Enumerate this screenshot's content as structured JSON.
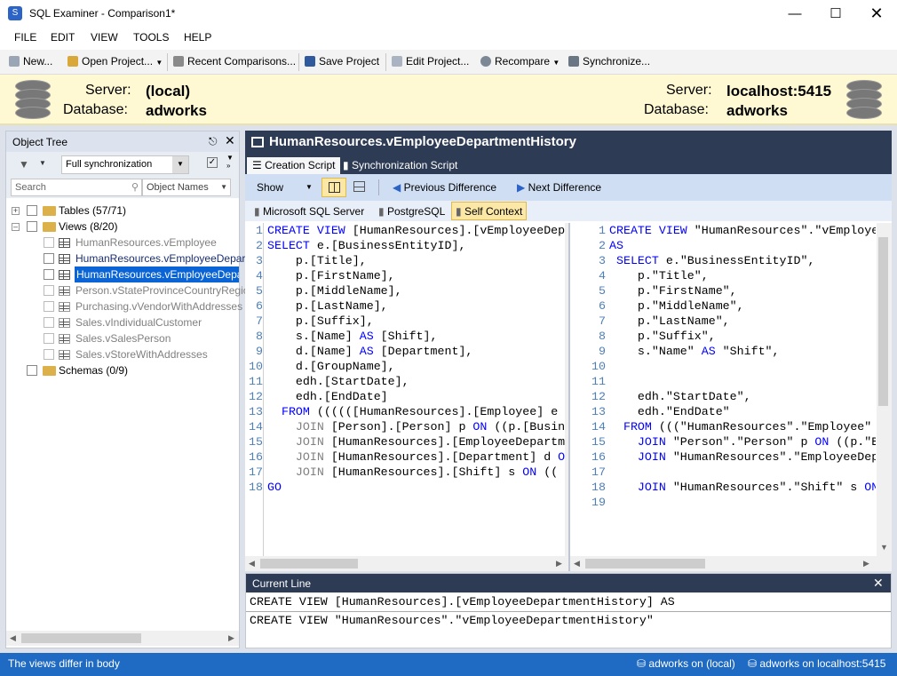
{
  "window": {
    "title": "SQL Examiner - Comparison1*",
    "icon": "app-icon"
  },
  "menu": [
    "FILE",
    "EDIT",
    "VIEW",
    "TOOLS",
    "HELP"
  ],
  "toolbar": {
    "new": "New...",
    "open_project": "Open Project...",
    "recent": "Recent Comparisons...",
    "save": "Save Project",
    "edit": "Edit Project...",
    "recompare": "Recompare",
    "synchronize": "Synchronize..."
  },
  "servers": {
    "left": {
      "server_label": "Server:",
      "server": "(local)",
      "database_label": "Database:",
      "database": "adworks"
    },
    "right": {
      "server_label": "Server:",
      "server": "localhost:5415",
      "database_label": "Database:",
      "database": "adworks"
    }
  },
  "object_tree": {
    "title": "Object Tree",
    "sync_mode": "Full synchronization",
    "search_placeholder": "Search",
    "search_scope": "Object Names",
    "items": [
      {
        "label": "Tables (57/71)"
      },
      {
        "label": "Views (8/20)"
      },
      {
        "label": "HumanResources.vEmployee"
      },
      {
        "label": "HumanResources.vEmployeeDepartment"
      },
      {
        "label": "HumanResources.vEmployeeDepartmentHistory"
      },
      {
        "label": "Person.vStateProvinceCountryRegion"
      },
      {
        "label": "Purchasing.vVendorWithAddresses"
      },
      {
        "label": "Sales.vIndividualCustomer"
      },
      {
        "label": "Sales.vSalesPerson"
      },
      {
        "label": "Sales.vStoreWithAddresses"
      },
      {
        "label": "Schemas (0/9)"
      }
    ]
  },
  "object_title": "HumanResources.vEmployeeDepartmentHistory",
  "tabs": {
    "creation": "Creation Script",
    "sync": "Synchronization Script"
  },
  "difftool": {
    "show": "Show",
    "prev": "Previous Difference",
    "next": "Next Difference"
  },
  "dbtypes": {
    "mssql": "Microsoft SQL Server",
    "pg": "PostgreSQL",
    "self": "Self Context"
  },
  "current_line": {
    "title": "Current Line",
    "line1": "CREATE VIEW [HumanResources].[vEmployeeDepartmentHistory] AS",
    "line2": "CREATE VIEW \"HumanResources\".\"vEmployeeDepartmentHistory\""
  },
  "status": {
    "message": "The views differ in body",
    "left_db": "adworks on (local)",
    "right_db": "adworks on localhost:5415"
  }
}
